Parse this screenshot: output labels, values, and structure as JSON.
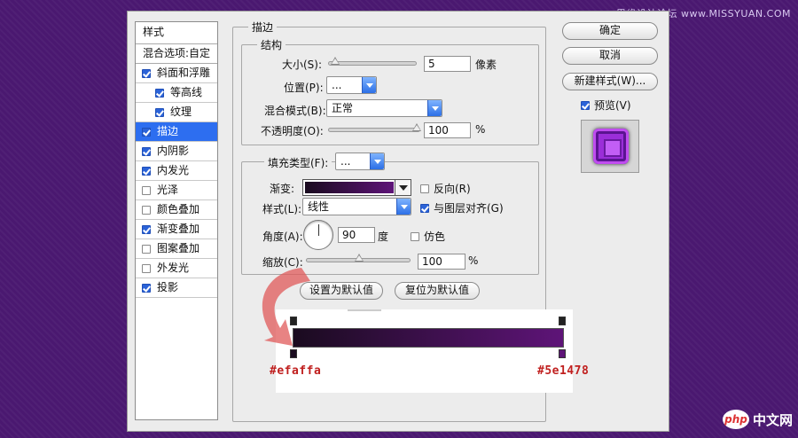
{
  "watermark": "思缘设计论坛 www.MISSYUAN.COM",
  "php_logo": {
    "badge": "php",
    "text": "中文网"
  },
  "styles_panel": {
    "title": "样式",
    "blend_options": "混合选项:自定",
    "items": [
      {
        "label": "斜面和浮雕",
        "checked": true,
        "sub": false,
        "active": false
      },
      {
        "label": "等高线",
        "checked": true,
        "sub": true,
        "active": false
      },
      {
        "label": "纹理",
        "checked": true,
        "sub": true,
        "active": false
      },
      {
        "label": "描边",
        "checked": true,
        "sub": false,
        "active": true
      },
      {
        "label": "内阴影",
        "checked": true,
        "sub": false,
        "active": false
      },
      {
        "label": "内发光",
        "checked": true,
        "sub": false,
        "active": false
      },
      {
        "label": "光泽",
        "checked": false,
        "sub": false,
        "active": false
      },
      {
        "label": "颜色叠加",
        "checked": false,
        "sub": false,
        "active": false
      },
      {
        "label": "渐变叠加",
        "checked": true,
        "sub": false,
        "active": false
      },
      {
        "label": "图案叠加",
        "checked": false,
        "sub": false,
        "active": false
      },
      {
        "label": "外发光",
        "checked": false,
        "sub": false,
        "active": false
      },
      {
        "label": "投影",
        "checked": true,
        "sub": false,
        "active": false
      }
    ]
  },
  "stroke": {
    "title": "描边",
    "structure": {
      "title": "结构",
      "size_label": "大小(S):",
      "size_value": "5",
      "size_unit": "像素",
      "size_slider": 0.02,
      "position_label": "位置(P):",
      "position_value": "...",
      "blend_label": "混合模式(B):",
      "blend_value": "正常",
      "opacity_label": "不透明度(O):",
      "opacity_value": "100",
      "opacity_unit": "%",
      "opacity_slider": 1.0
    },
    "fill": {
      "fill_type_label": "填充类型(F):",
      "fill_type_value": "...",
      "gradient_label": "渐变:",
      "reverse_label": "反向(R)",
      "reverse_checked": false,
      "style_label": "样式(L):",
      "style_value": "线性",
      "align_label": "与图层对齐(G)",
      "align_checked": true,
      "angle_label": "角度(A):",
      "angle_value": "90",
      "angle_unit": "度",
      "dither_label": "仿色",
      "dither_checked": false,
      "scale_label": "缩放(C):",
      "scale_value": "100",
      "scale_unit": "%",
      "scale_slider": 0.5,
      "set_default_btn": "设置为默认值",
      "reset_default_btn": "复位为默认值"
    }
  },
  "buttons": {
    "ok": "确定",
    "cancel": "取消",
    "new_style": "新建样式(W)...",
    "preview_label": "预览(V)",
    "preview_checked": true
  },
  "gradient": {
    "color_start": "#1a0b1f",
    "color_end": "#5e1478",
    "label_start": "#efaffa",
    "label_end": "#5e1478"
  },
  "colors": {
    "accent": "#2d6ef0",
    "background": "#4a1870",
    "annotation": "#e05a5a"
  }
}
